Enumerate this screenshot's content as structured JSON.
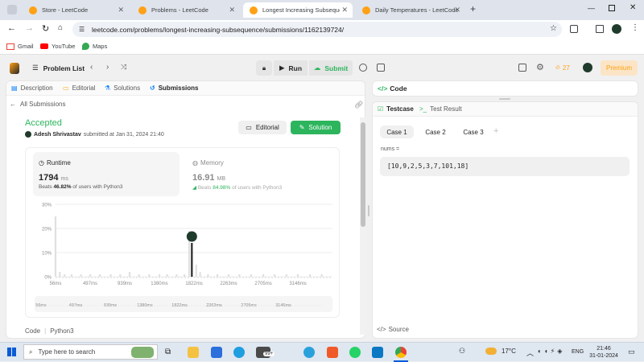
{
  "browser": {
    "tabs": [
      {
        "title": "Store - LeetCode",
        "active": false
      },
      {
        "title": "Problems - LeetCode",
        "active": false
      },
      {
        "title": "Longest Increasing Subsequenc",
        "active": true
      },
      {
        "title": "Daily Temperatures - LeetCode",
        "active": false
      }
    ],
    "url": "leetcode.com/problems/longest-increasing-subsequence/submissions/1162139724/",
    "bookmarks": [
      "Gmail",
      "YouTube",
      "Maps"
    ]
  },
  "nav": {
    "problem_list": "Problem List",
    "run": "Run",
    "submit": "Submit",
    "streak": "27",
    "premium": "Premium"
  },
  "left_panel": {
    "tabs": [
      "Description",
      "Editorial",
      "Solutions",
      "Submissions"
    ],
    "all_submissions": "All Submissions",
    "status": "Accepted",
    "author": "Adesh Shrivastav",
    "submitted_at": "submitted at Jan 31, 2024 21:40",
    "editorial_btn": "Editorial",
    "solution_btn": "Solution",
    "runtime": {
      "label": "Runtime",
      "value": "1794",
      "unit": "ms",
      "beats_prefix": "Beats",
      "beats_value": "46.82%",
      "beats_suffix": "of users with Python3"
    },
    "memory": {
      "label": "Memory",
      "value": "16.91",
      "unit": "MB",
      "beats_prefix": "Beats",
      "beats_value": "84.98%",
      "beats_suffix": "of users with Python3"
    },
    "code_label": "Code",
    "language": "Python3"
  },
  "chart_data": {
    "type": "bar",
    "y_ticks": [
      "30%",
      "20%",
      "10%",
      "0%"
    ],
    "ylim": [
      0,
      30
    ],
    "x_ticks": [
      "56ms",
      "497ms",
      "939ms",
      "1380ms",
      "1822ms",
      "2263ms",
      "2705ms",
      "3146ms"
    ],
    "xlim": [
      56,
      3587
    ],
    "bars": [
      {
        "x": 56,
        "y": 25
      },
      {
        "x": 110,
        "y": 2
      },
      {
        "x": 170,
        "y": 1
      },
      {
        "x": 260,
        "y": 1
      },
      {
        "x": 380,
        "y": 1
      },
      {
        "x": 497,
        "y": 1
      },
      {
        "x": 620,
        "y": 1
      },
      {
        "x": 760,
        "y": 1
      },
      {
        "x": 880,
        "y": 1
      },
      {
        "x": 1000,
        "y": 2
      },
      {
        "x": 1120,
        "y": 1
      },
      {
        "x": 1250,
        "y": 1
      },
      {
        "x": 1380,
        "y": 1
      },
      {
        "x": 1480,
        "y": 1
      },
      {
        "x": 1600,
        "y": 1
      },
      {
        "x": 1700,
        "y": 1
      },
      {
        "x": 1760,
        "y": 19
      },
      {
        "x": 1794,
        "y": 14
      },
      {
        "x": 1850,
        "y": 5
      },
      {
        "x": 1900,
        "y": 2
      },
      {
        "x": 2000,
        "y": 1
      },
      {
        "x": 2120,
        "y": 1
      },
      {
        "x": 2263,
        "y": 1
      },
      {
        "x": 2400,
        "y": 1
      },
      {
        "x": 2550,
        "y": 1
      },
      {
        "x": 2705,
        "y": 1
      },
      {
        "x": 2850,
        "y": 1
      },
      {
        "x": 3000,
        "y": 1
      },
      {
        "x": 3146,
        "y": 1
      },
      {
        "x": 3300,
        "y": 1
      },
      {
        "x": 3450,
        "y": 1
      }
    ],
    "highlight_x": 1794
  },
  "right_panel": {
    "code_title": "Code",
    "testcase_tab": "Testcase",
    "result_tab": "Test Result",
    "cases": [
      "Case 1",
      "Case 2",
      "Case 3"
    ],
    "input_label": "nums =",
    "input_value": "[10,9,2,5,3,7,101,18]",
    "source_label": "Source"
  },
  "taskbar": {
    "search_placeholder": "Type here to search",
    "weather": "17°C",
    "lang": "ENG",
    "time": "21:46",
    "date": "31-01-2024",
    "badge": "99+"
  },
  "colors": {
    "accent_green": "#2db55d",
    "chart_bar": "#e0e0e0",
    "highlight": "#262626",
    "premium": "#ffa116"
  }
}
